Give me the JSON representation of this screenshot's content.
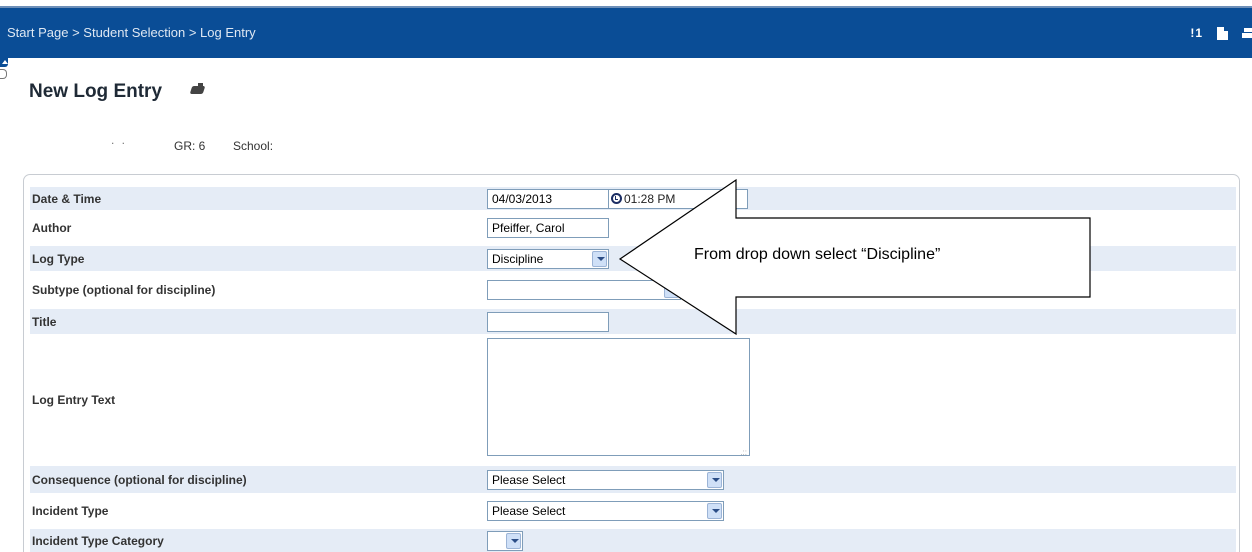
{
  "header": {
    "breadcrumb": [
      "Start Page",
      "Student Selection",
      "Log Entry"
    ],
    "separator": ">",
    "alert_count": "!1",
    "icons": [
      "alert-icon",
      "document-icon",
      "print-icon"
    ]
  },
  "page": {
    "title": "New Log Entry",
    "title_icon": "camera-icon"
  },
  "student": {
    "name_placeholder": ". .",
    "grade": "GR: 6",
    "school": "School:"
  },
  "form": {
    "date_time": {
      "label": "Date & Time",
      "date": "04/03/2013",
      "time": "01:28 PM"
    },
    "author": {
      "label": "Author",
      "value": "Pfeiffer, Carol"
    },
    "log_type": {
      "label": "Log Type",
      "selected": "Discipline"
    },
    "subtype": {
      "label": "Subtype (optional for discipline)",
      "selected": ""
    },
    "title": {
      "label": "Title",
      "value": ""
    },
    "log_entry_text": {
      "label": "Log Entry Text",
      "value": ""
    },
    "consequence": {
      "label": "Consequence (optional for discipline)",
      "selected": "Please Select"
    },
    "incident_type": {
      "label": "Incident Type",
      "selected": "Please Select"
    },
    "incident_type_category": {
      "label": "Incident Type Category",
      "selected": ""
    }
  },
  "callout": {
    "text": "From drop down select “Discipline”"
  },
  "colors": {
    "header_bg": "#0a4d96",
    "row_shade": "#e5ecf6",
    "input_border": "#7f9db9"
  }
}
